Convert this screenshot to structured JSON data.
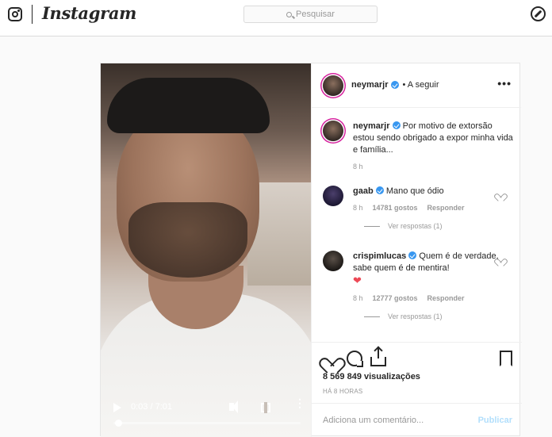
{
  "nav": {
    "wordmark": "Instagram",
    "search_placeholder": "Pesquisar"
  },
  "video": {
    "time": "0:03 / 7:01",
    "progress_fraction": 0.007
  },
  "post": {
    "username": "neymarjr",
    "follow_label": "• A seguir",
    "caption_user": "neymarjr",
    "caption_text": "Por motivo de extorsão estou sendo obrigado a expor minha vida e família...",
    "caption_time": "8 h",
    "comments": [
      {
        "username": "gaab",
        "text": "Mano que ódio",
        "time": "8 h",
        "likes": "14781 gostos",
        "reply_label": "Responder",
        "view_replies": "Ver respostas (1)"
      },
      {
        "username": "crispimlucas",
        "text": "Quem é de verdade, sabe quem é de mentira!",
        "emoji": "❤",
        "time": "8 h",
        "likes": "12777 gostos",
        "reply_label": "Responder",
        "view_replies": "Ver respostas (1)"
      }
    ],
    "views": "8 569 849 visualizações",
    "posted_ago": "HÁ 8 HORAS",
    "comment_placeholder": "Adiciona um comentário...",
    "publish_label": "Publicar"
  },
  "colors": {
    "verified": "#3897f0",
    "like_red": "#ed4956",
    "publish_disabled": "#b2dffc"
  }
}
